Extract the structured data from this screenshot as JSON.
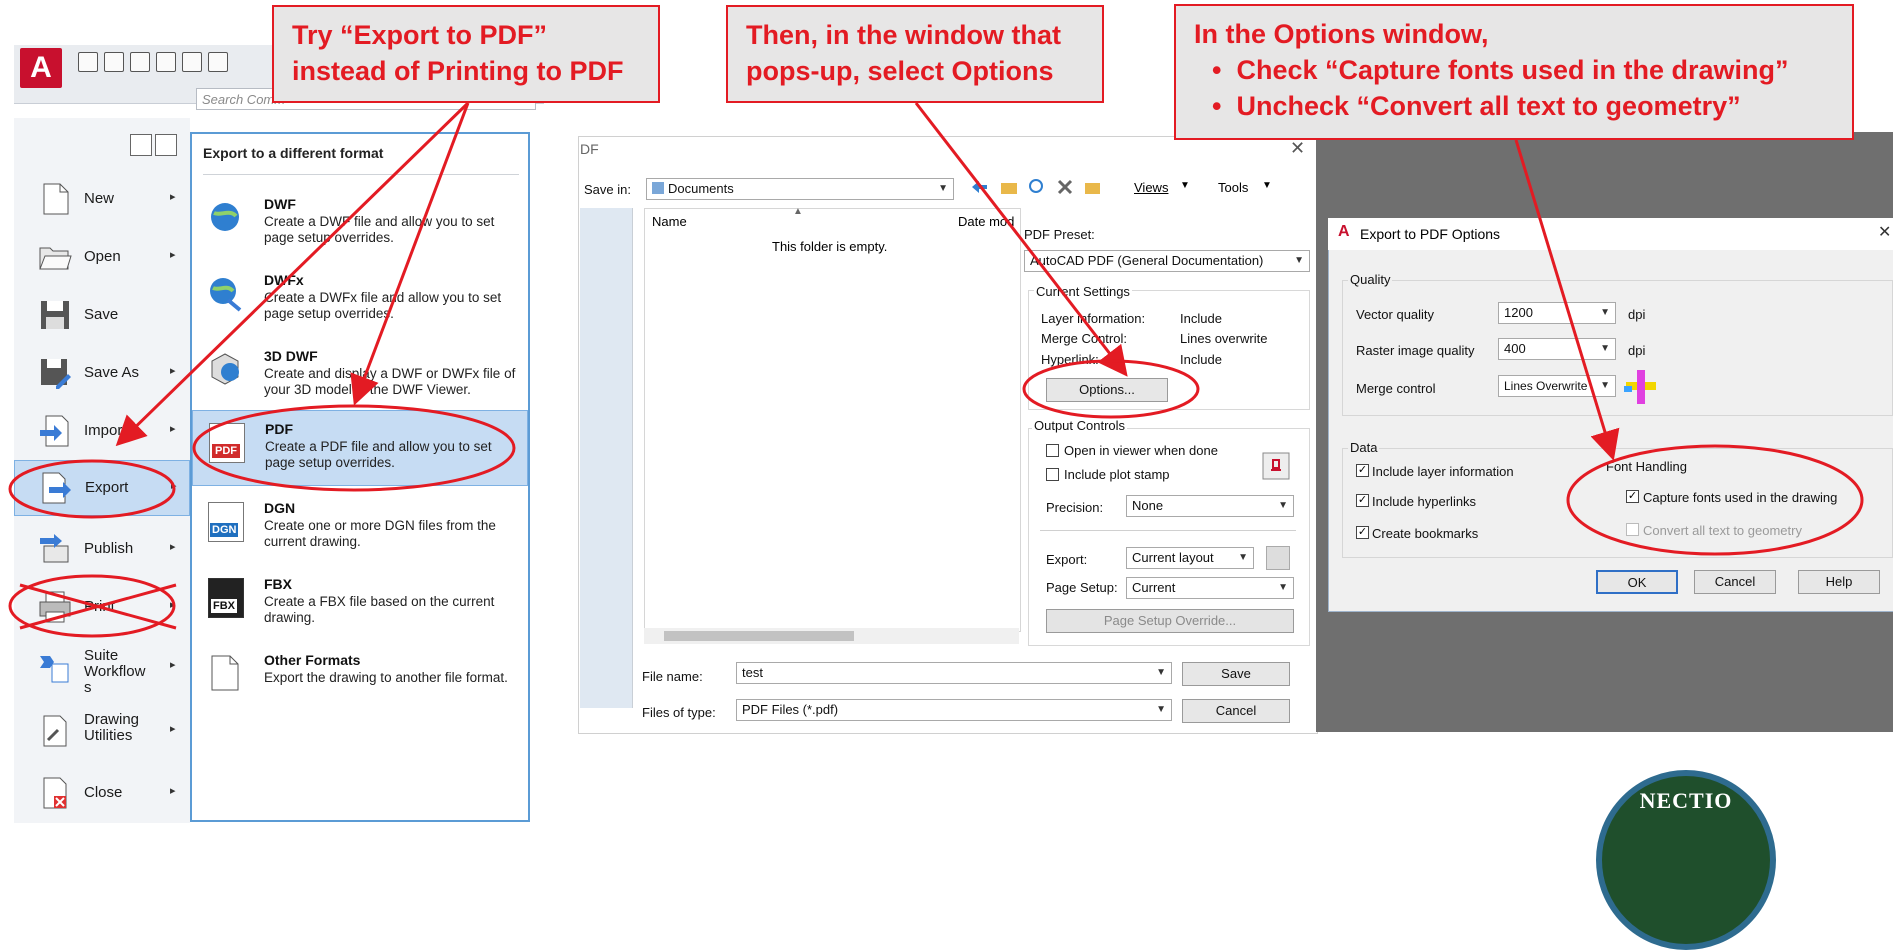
{
  "callouts": {
    "c1_line1": "Try “Export to PDF”",
    "c1_line2": "instead of Printing to PDF",
    "c2_line1": "Then, in the window that",
    "c2_line2": "pops-up, select Options",
    "c3_line1": "In the Options window,",
    "c3_bullet1": "Check “Capture fonts used in the drawing”",
    "c3_bullet2": "Uncheck “Convert all text to geometry”",
    "bullet": "•"
  },
  "appmenu": {
    "logo": "A",
    "search_placeholder": "Search Comm",
    "left_items": [
      {
        "label": "New",
        "icon": "new-drawing-icon"
      },
      {
        "label": "Open",
        "icon": "open-folder-icon"
      },
      {
        "label": "Save",
        "icon": "save-disk-icon"
      },
      {
        "label": "Save As",
        "icon": "save-as-icon"
      },
      {
        "label": "Import",
        "icon": "import-icon"
      },
      {
        "label": "Export",
        "icon": "export-icon"
      },
      {
        "label": "Publish",
        "icon": "publish-icon"
      },
      {
        "label": "Print",
        "icon": "print-icon"
      },
      {
        "label": "Suite\nWorkflow\ns",
        "icon": "suite-workflows-icon"
      },
      {
        "label": "Drawing\nUtilities",
        "icon": "drawing-utilities-icon"
      },
      {
        "label": "Close",
        "icon": "close-drawing-icon"
      }
    ],
    "arrow": "▸",
    "submenu_title": "Export to a different format",
    "formats": [
      {
        "title": "DWF",
        "desc": "Create a DWF file and allow you to set page setup overrides.",
        "icon": "dwf-globe-icon"
      },
      {
        "title": "DWFx",
        "desc": "Create a DWFx file and allow you to set page setup overrides.",
        "icon": "dwfx-globe-icon"
      },
      {
        "title": "3D DWF",
        "desc": "Create and display a DWF or DWFx file of your 3D model in the DWF Viewer.",
        "icon": "3d-dwf-icon"
      },
      {
        "title": "PDF",
        "desc": "Create a PDF file and allow you to set page setup overrides.",
        "icon": "pdf-file-icon",
        "badge": "PDF"
      },
      {
        "title": "DGN",
        "desc": "Create one or more DGN files from the current drawing.",
        "icon": "dgn-file-icon",
        "badge": "DGN"
      },
      {
        "title": "FBX",
        "desc": "Create a FBX file based on the current drawing.",
        "icon": "fbx-file-icon",
        "badge": "FBX"
      },
      {
        "title": "Other Formats",
        "desc": "Export the drawing to another file format.",
        "icon": "blank-file-icon"
      }
    ]
  },
  "savedlg": {
    "title": "DF",
    "close": "✕",
    "save_in_label": "Save in:",
    "save_in_value": "Documents",
    "views": "Views",
    "tools": "Tools",
    "col_name": "Name",
    "col_date": "Date mod",
    "empty": "This folder is empty.",
    "pdf_preset_label": "PDF Preset:",
    "pdf_preset_value": "AutoCAD PDF (General Documentation)",
    "current_settings": "Current Settings",
    "settings": [
      {
        "k": "Layer information:",
        "v": "Include"
      },
      {
        "k": "Merge Control:",
        "v": "Lines overwrite"
      },
      {
        "k": "Hyperlink:",
        "v": "Include"
      }
    ],
    "options_btn": "Options...",
    "output_controls": "Output Controls",
    "open_viewer": "Open in viewer when done",
    "include_stamp": "Include plot stamp",
    "precision_label": "Precision:",
    "precision_value": "None",
    "export_label": "Export:",
    "export_value": "Current layout",
    "page_setup_label": "Page Setup:",
    "page_setup_value": "Current",
    "page_setup_override": "Page Setup Override...",
    "file_name_label": "File name:",
    "file_name_value": "test",
    "files_type_label": "Files of type:",
    "files_type_value": "PDF Files (*.pdf)",
    "save_btn": "Save",
    "cancel_btn": "Cancel"
  },
  "optdlg": {
    "title": "Export to PDF Options",
    "close": "✕",
    "quality": "Quality",
    "vector_label": "Vector quality",
    "vector_value": "1200",
    "raster_label": "Raster image quality",
    "raster_value": "400",
    "dpi": "dpi",
    "merge_label": "Merge control",
    "merge_value": "Lines Overwrite",
    "data": "Data",
    "include_layer": "Include layer information",
    "include_hyperlinks": "Include hyperlinks",
    "create_bookmarks": "Create bookmarks",
    "font_handling": "Font Handling",
    "capture_fonts": "Capture fonts used in the drawing",
    "convert_text": "Convert all text to geometry",
    "ok": "OK",
    "cancel": "Cancel",
    "help": "Help",
    "check": "✓"
  },
  "seal_text": "NECTIO",
  "colors": {
    "accent_red": "#e31b23",
    "selection_blue": "#c6dcf3",
    "autocad_red": "#c8102e"
  }
}
